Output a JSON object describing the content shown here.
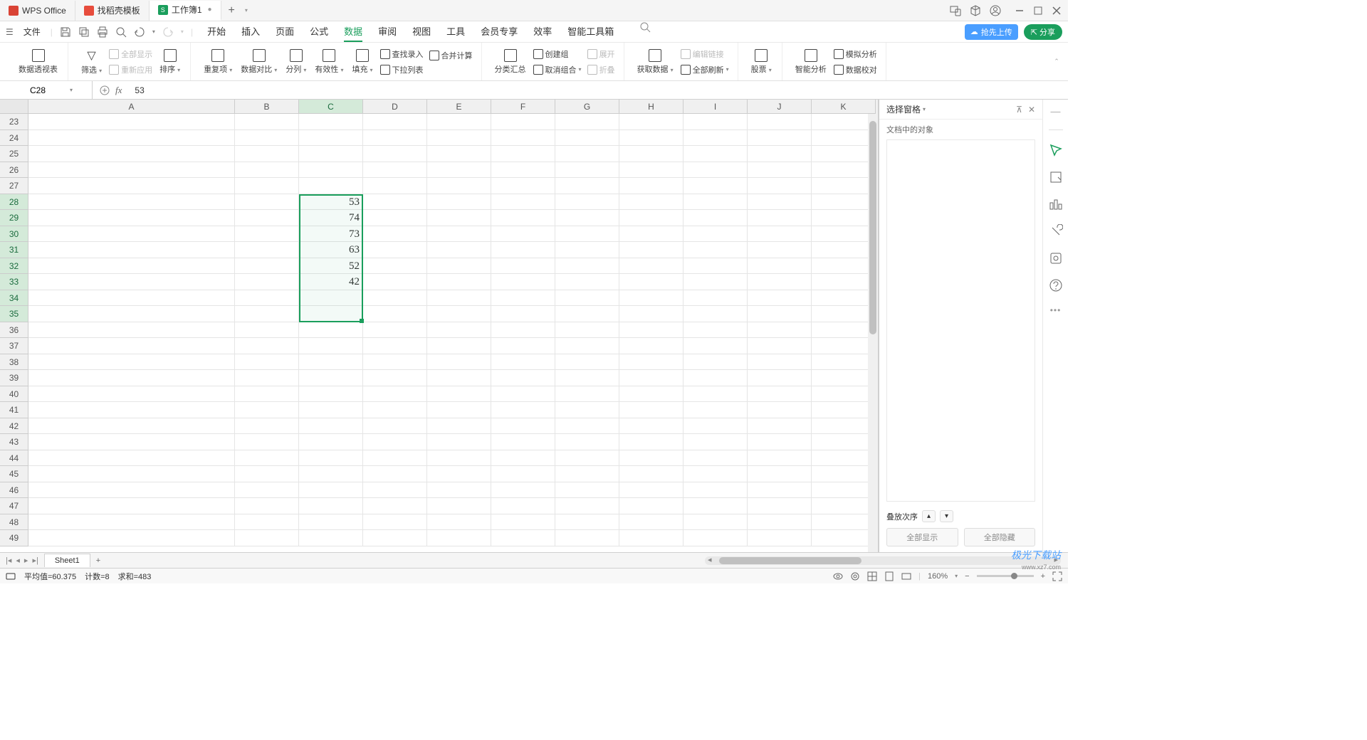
{
  "titlebar": {
    "tabs": [
      {
        "label": "WPS Office"
      },
      {
        "label": "找稻壳模板"
      },
      {
        "label": "工作簿1"
      }
    ]
  },
  "menubar": {
    "file": "文件",
    "tabs": [
      "开始",
      "插入",
      "页面",
      "公式",
      "数据",
      "审阅",
      "视图",
      "工具",
      "会员专享",
      "效率",
      "智能工具箱"
    ],
    "active": "数据",
    "upload": "抢先上传",
    "share": "分享"
  },
  "ribbon": {
    "pivot": "数据透视表",
    "filter": "筛选",
    "showall": "全部显示",
    "reapply": "重新应用",
    "sort": "排序",
    "dedup": "重复项",
    "compare": "数据对比",
    "split": "分列",
    "validate": "有效性",
    "fill": "填充",
    "lookup": "查找录入",
    "consolidate": "合并计算",
    "dropdown": "下拉列表",
    "subtotal": "分类汇总",
    "group": "创建组",
    "ungroup": "取消组合",
    "expand": "展开",
    "collapse": "折叠",
    "getdata": "获取数据",
    "editlinks": "编辑链接",
    "refresh": "全部刷新",
    "stocks": "股票",
    "smart": "智能分析",
    "whatif": "模拟分析",
    "audit": "数据校对"
  },
  "namebox": "C28",
  "formula": "53",
  "columns": [
    "A",
    "B",
    "C",
    "D",
    "E",
    "F",
    "G",
    "H",
    "I",
    "J",
    "K"
  ],
  "row_start": 23,
  "row_end": 49,
  "cells": {
    "C28": "53",
    "C29": "74",
    "C30": "73",
    "C31": "63",
    "C32": "52",
    "C33": "42"
  },
  "selection": {
    "col": "C",
    "r1": 28,
    "r2": 35
  },
  "rightpanel": {
    "title": "选择窗格",
    "sub": "文档中的对象",
    "layer": "叠放次序",
    "showall": "全部显示",
    "hideall": "全部隐藏"
  },
  "sheets": {
    "active": "Sheet1"
  },
  "statusbar": {
    "avg": "平均值=60.375",
    "count": "计数=8",
    "sum": "求和=483",
    "zoom": "160%"
  },
  "watermark": "极光下载站",
  "watermark_sub": "www.xz7.com"
}
